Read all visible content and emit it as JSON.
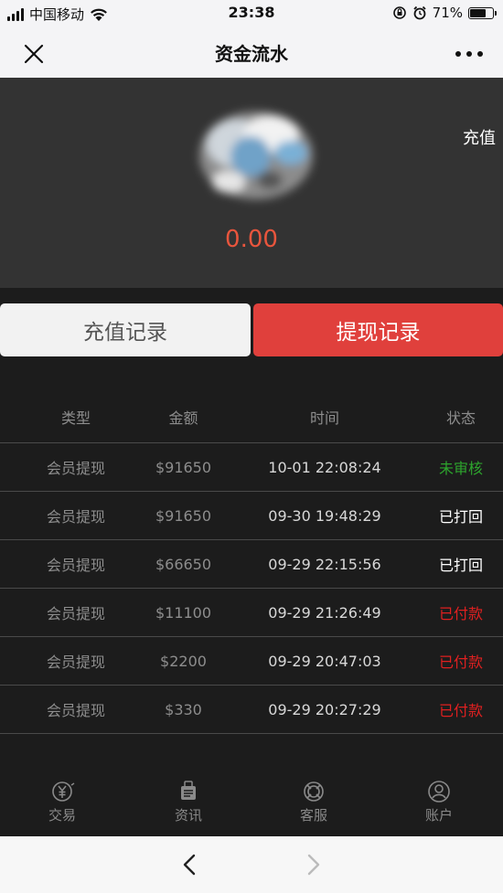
{
  "status_bar": {
    "carrier": "中国移动",
    "time": "23:38",
    "battery": "71%",
    "battery_level": 0.71,
    "icons": [
      "signal-icon",
      "wifi-icon",
      "orientation-lock-icon",
      "alarm-icon",
      "battery-icon"
    ]
  },
  "nav": {
    "title": "资金流水",
    "close_icon": "close-icon",
    "more_icon": "more-icon"
  },
  "header": {
    "recharge_label": "充值",
    "balance": "0.00"
  },
  "tabs": [
    {
      "label": "充值记录",
      "active": false
    },
    {
      "label": "提现记录",
      "active": true
    }
  ],
  "table": {
    "columns": [
      "类型",
      "金额",
      "时间",
      "状态"
    ],
    "rows": [
      {
        "type": "会员提现",
        "amount": "$91650",
        "time": "10-01 22:08:24",
        "status": "未审核",
        "status_color": "#2da42d"
      },
      {
        "type": "会员提现",
        "amount": "$91650",
        "time": "09-30 19:48:29",
        "status": "已打回",
        "status_color": "#ffffff"
      },
      {
        "type": "会员提现",
        "amount": "$66650",
        "time": "09-29 22:15:56",
        "status": "已打回",
        "status_color": "#ffffff"
      },
      {
        "type": "会员提现",
        "amount": "$11100",
        "time": "09-29 21:26:49",
        "status": "已付款",
        "status_color": "#e02020"
      },
      {
        "type": "会员提现",
        "amount": "$2200",
        "time": "09-29 20:47:03",
        "status": "已付款",
        "status_color": "#e02020"
      },
      {
        "type": "会员提现",
        "amount": "$330",
        "time": "09-29 20:27:29",
        "status": "已付款",
        "status_color": "#e02020"
      }
    ]
  },
  "tabbar": {
    "items": [
      {
        "label": "交易",
        "icon": "yen-coin-icon"
      },
      {
        "label": "资讯",
        "icon": "news-icon"
      },
      {
        "label": "客服",
        "icon": "support-icon"
      },
      {
        "label": "账户",
        "icon": "user-icon"
      }
    ]
  },
  "browser": {
    "back_icon": "back-arrow-icon",
    "forward_icon": "forward-arrow-icon"
  },
  "colors": {
    "accent_red": "#e0403c",
    "balance_orange": "#e8553d",
    "panel_dark": "#333333",
    "background": "#1c1c1c"
  }
}
